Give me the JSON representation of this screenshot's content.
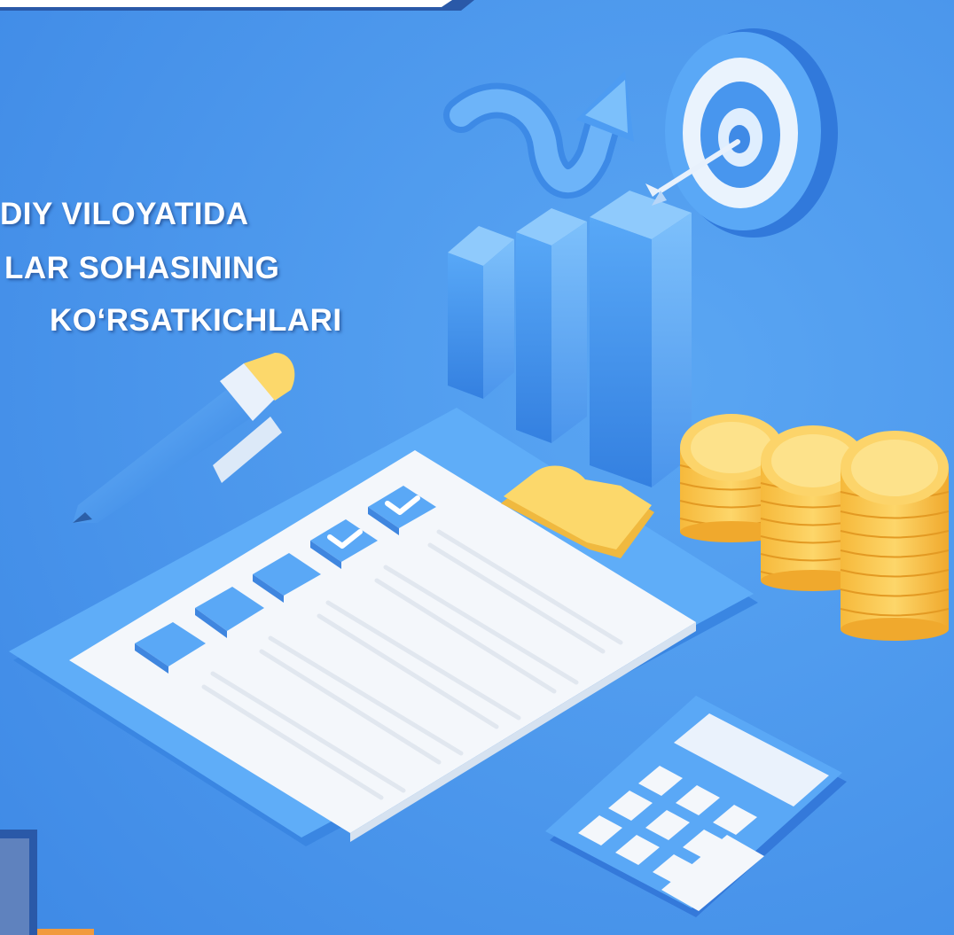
{
  "title": {
    "line1": "DIY VILOYATIDA",
    "line2": "LAR  SOHASINING",
    "line3": "KO‘RSATKICHLARI"
  },
  "colors": {
    "background": "#4e9bef",
    "accent_blue": "#3f8fe6",
    "paper": "#f4f7fb",
    "coin": "#fcd86b",
    "clip": "#fcd86b",
    "frame_dark": "#2a59a8",
    "frame_orange": "#f19a3e"
  },
  "icons": [
    "target-icon",
    "arrow-icon",
    "bar-chart-icon",
    "pen-icon",
    "clipboard-icon",
    "checkbox-icon",
    "coins-icon",
    "calculator-icon"
  ],
  "checklist": {
    "checked": [
      false,
      false,
      false,
      true,
      true
    ]
  }
}
